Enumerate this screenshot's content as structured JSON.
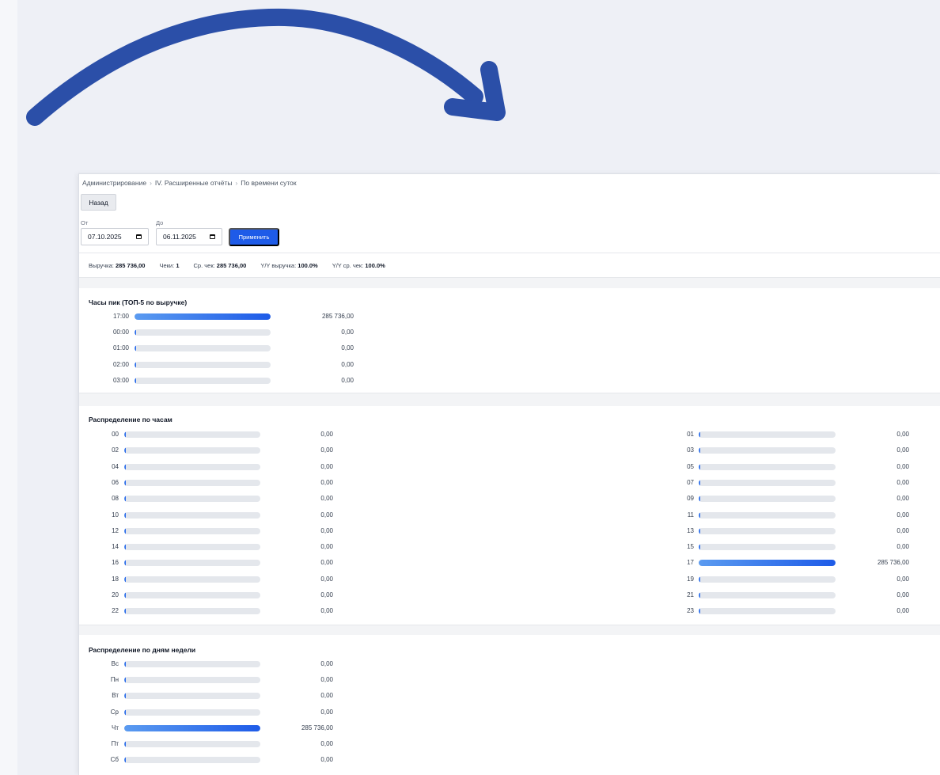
{
  "breadcrumb": [
    "Администрирование",
    "IV. Расширенные отчёты",
    "По времени суток"
  ],
  "back_label": "Назад",
  "filter": {
    "from_label": "От",
    "to_label": "До",
    "from_value": "07.10.2025",
    "to_value": "06.11.2025",
    "apply_label": "Применить"
  },
  "stats": [
    {
      "label": "Выручка:",
      "value": "285 736,00"
    },
    {
      "label": "Чеки:",
      "value": "1"
    },
    {
      "label": "Ср. чек:",
      "value": "285 736,00"
    },
    {
      "label": "Y/Y выручка:",
      "value": "100.0%"
    },
    {
      "label": "Y/Y ср. чек:",
      "value": "100.0%"
    }
  ],
  "peak": {
    "title": "Часы пик (ТОП-5 по выручке)",
    "rows": [
      {
        "label": "17:00",
        "value": "285 736,00",
        "share": 1
      },
      {
        "label": "00:00",
        "value": "0,00",
        "share": 0
      },
      {
        "label": "01:00",
        "value": "0,00",
        "share": 0
      },
      {
        "label": "02:00",
        "value": "0,00",
        "share": 0
      },
      {
        "label": "03:00",
        "value": "0,00",
        "share": 0
      }
    ]
  },
  "hours": {
    "title": "Распределение по часам",
    "left": [
      {
        "label": "00",
        "value": "0,00",
        "share": 0
      },
      {
        "label": "02",
        "value": "0,00",
        "share": 0
      },
      {
        "label": "04",
        "value": "0,00",
        "share": 0
      },
      {
        "label": "06",
        "value": "0,00",
        "share": 0
      },
      {
        "label": "08",
        "value": "0,00",
        "share": 0
      },
      {
        "label": "10",
        "value": "0,00",
        "share": 0
      },
      {
        "label": "12",
        "value": "0,00",
        "share": 0
      },
      {
        "label": "14",
        "value": "0,00",
        "share": 0
      },
      {
        "label": "16",
        "value": "0,00",
        "share": 0
      },
      {
        "label": "18",
        "value": "0,00",
        "share": 0
      },
      {
        "label": "20",
        "value": "0,00",
        "share": 0
      },
      {
        "label": "22",
        "value": "0,00",
        "share": 0
      }
    ],
    "right": [
      {
        "label": "01",
        "value": "0,00",
        "share": 0
      },
      {
        "label": "03",
        "value": "0,00",
        "share": 0
      },
      {
        "label": "05",
        "value": "0,00",
        "share": 0
      },
      {
        "label": "07",
        "value": "0,00",
        "share": 0
      },
      {
        "label": "09",
        "value": "0,00",
        "share": 0
      },
      {
        "label": "11",
        "value": "0,00",
        "share": 0
      },
      {
        "label": "13",
        "value": "0,00",
        "share": 0
      },
      {
        "label": "15",
        "value": "0,00",
        "share": 0
      },
      {
        "label": "17",
        "value": "285 736,00",
        "share": 1
      },
      {
        "label": "19",
        "value": "0,00",
        "share": 0
      },
      {
        "label": "21",
        "value": "0,00",
        "share": 0
      },
      {
        "label": "23",
        "value": "0,00",
        "share": 0
      }
    ]
  },
  "weekdays": {
    "title": "Распределение по дням недели",
    "rows": [
      {
        "label": "Вс",
        "value": "0,00",
        "share": 0
      },
      {
        "label": "Пн",
        "value": "0,00",
        "share": 0
      },
      {
        "label": "Вт",
        "value": "0,00",
        "share": 0
      },
      {
        "label": "Ср",
        "value": "0,00",
        "share": 0
      },
      {
        "label": "Чт",
        "value": "285 736,00",
        "share": 1
      },
      {
        "label": "Пт",
        "value": "0,00",
        "share": 0
      },
      {
        "label": "Сб",
        "value": "0,00",
        "share": 0
      }
    ]
  },
  "colors": {
    "arrow": "#2b4fa8",
    "accent": "#1e5be8",
    "bar_gradient_start": "#5b9bf0",
    "bar_track": "#e4e7ec"
  }
}
